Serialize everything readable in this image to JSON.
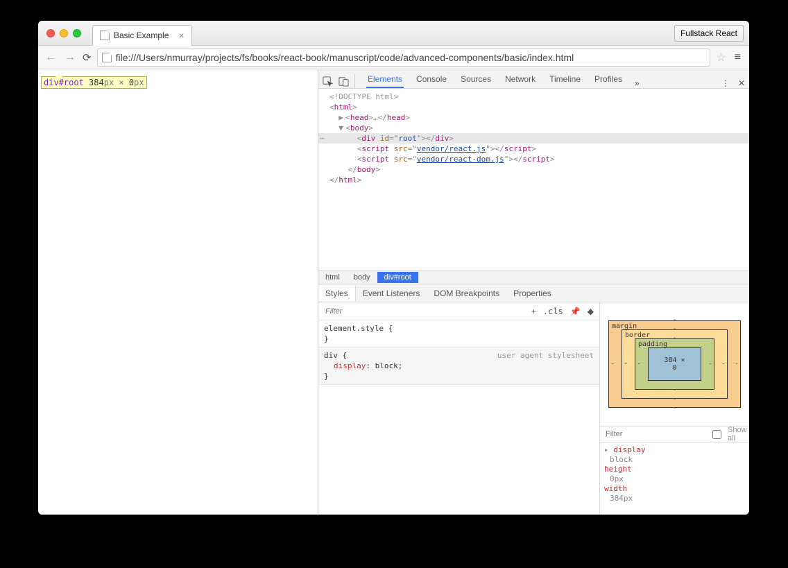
{
  "window": {
    "tab_title": "Basic Example",
    "extension_button": "Fullstack React",
    "url": "file:///Users/nmurray/projects/fs/books/react-book/manuscript/code/advanced-components/basic/index.html"
  },
  "page_overlay": {
    "selector": "div#root",
    "width": "384",
    "width_unit": "px",
    "sep": " × ",
    "height": "0",
    "height_unit": "px"
  },
  "devtools": {
    "tabs": [
      "Elements",
      "Console",
      "Sources",
      "Network",
      "Timeline",
      "Profiles"
    ],
    "active_tab": "Elements",
    "breadcrumb": [
      "html",
      "body",
      "div#root"
    ],
    "breadcrumb_selected": "div#root",
    "dom": {
      "doctype": "<!DOCTYPE html>",
      "html_open": "html",
      "head": "head",
      "head_ellipsis": "…",
      "body": "body",
      "div_tag": "div",
      "div_attr": "id",
      "div_val": "root",
      "script1_tag": "script",
      "script1_attr": "src",
      "script1_val": "vendor/react.js",
      "script2_tag": "script",
      "script2_attr": "src",
      "script2_val": "vendor/react-dom.js"
    },
    "sub_tabs": [
      "Styles",
      "Event Listeners",
      "DOM Breakpoints",
      "Properties"
    ],
    "sub_tab_active": "Styles",
    "styles": {
      "filter_placeholder": "Filter",
      "cls_label": ".cls",
      "rule1_selector": "element.style",
      "rule2_selector": "div",
      "rule2_origin": "user agent stylesheet",
      "rule2_prop": "display",
      "rule2_val": "block"
    },
    "box_model": {
      "margin_label": "margin",
      "border_label": "border",
      "padding_label": "padding",
      "content": "384 × 0",
      "dash": "-"
    },
    "computed": {
      "filter_placeholder": "Filter",
      "show_all_label": "Show all",
      "props": [
        {
          "k": "display",
          "v": "block"
        },
        {
          "k": "height",
          "v": "0px"
        },
        {
          "k": "width",
          "v": "384px"
        }
      ]
    }
  }
}
